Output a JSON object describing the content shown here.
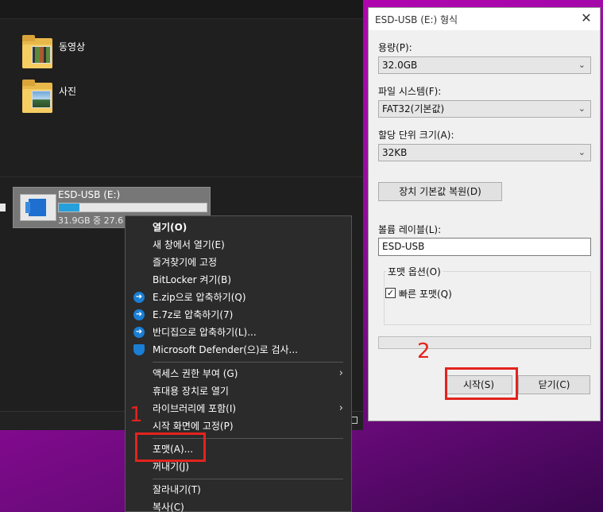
{
  "explorer": {
    "folders": [
      {
        "label": "동영상",
        "icon": "video-folder-icon"
      },
      {
        "label": "사진",
        "icon": "photo-folder-icon"
      }
    ],
    "drive": {
      "title": "ESD-USB (E:)",
      "used_fraction": 0.14,
      "space_text": "31.9GB 중 27.6"
    }
  },
  "context_menu": {
    "items": [
      {
        "label": "열기(O)",
        "bold": true
      },
      {
        "label": "새 창에서 열기(E)"
      },
      {
        "label": "즐겨찾기에 고정"
      },
      {
        "label": "BitLocker 켜기(B)"
      },
      {
        "label": "E.zip으로 압축하기(Q)",
        "icon": "bandizip-icon"
      },
      {
        "label": "E.7z로 압축하기(7)",
        "icon": "bandizip-icon"
      },
      {
        "label": "반디집으로 압축하기(L)...",
        "icon": "bandizip-icon"
      },
      {
        "label": "Microsoft Defender(으)로 검사...",
        "icon": "defender-shield-icon"
      },
      {
        "label": "액세스 권한 부여 (G)",
        "submenu": true
      },
      {
        "label": "휴대용 장치로 열기"
      },
      {
        "label": "라이브러리에 포함(I)",
        "submenu": true
      },
      {
        "label": "시작 화면에 고정(P)"
      },
      {
        "label": "포맷(A)..."
      },
      {
        "label": "꺼내기(J)"
      },
      {
        "label": "잘라내기(T)"
      },
      {
        "label": "복사(C)"
      }
    ]
  },
  "format_dialog": {
    "title": "ESD-USB (E:) 형식",
    "capacity_label": "용량(P):",
    "capacity_value": "32.0GB",
    "fs_label": "파일 시스템(F):",
    "fs_value": "FAT32(기본값)",
    "alloc_label": "할당 단위 크기(A):",
    "alloc_value": "32KB",
    "restore_label": "장치 기본값 복원(D)",
    "volume_label": "볼륨 레이블(L):",
    "volume_value": "ESD-USB",
    "options_label": "포맷 옵션(O)",
    "quick_format_label": "빠른 포맷(Q)",
    "quick_format_checked": true,
    "progress": 0,
    "start_label": "시작(S)",
    "close_label": "닫기(C)"
  },
  "annotations": {
    "step1": "1",
    "step2": "2",
    "color": "#e3231d"
  }
}
